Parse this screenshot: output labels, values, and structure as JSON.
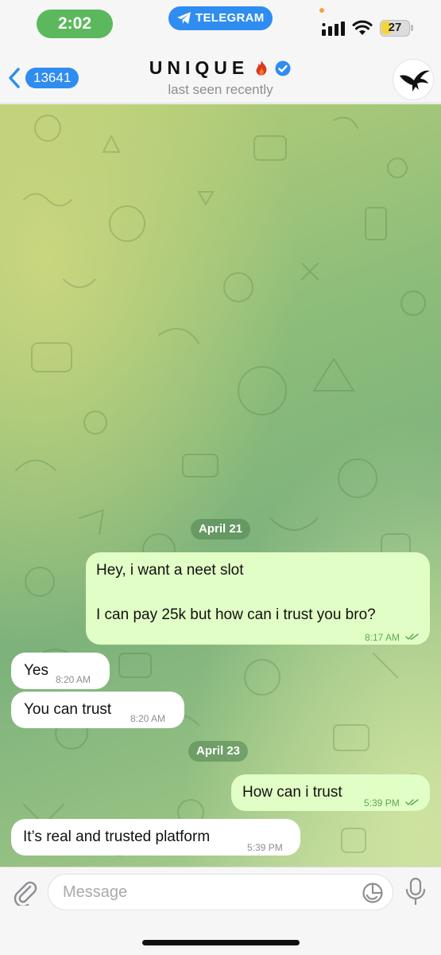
{
  "status_bar": {
    "time": "2:02",
    "app_pill": "TELEGRAM",
    "battery": "27"
  },
  "header": {
    "back_count": "13641",
    "title": "UNIQUE",
    "subtitle": "last seen recently"
  },
  "messages": [
    {
      "type": "date",
      "text": "April 21"
    },
    {
      "type": "out",
      "lines": [
        "Hey, i want a neet slot",
        "I can pay 25k but how can i trust you bro?"
      ],
      "time": "8:17 AM",
      "status": "read"
    },
    {
      "type": "in",
      "text": "Yes",
      "time": "8:20 AM"
    },
    {
      "type": "in",
      "text": "You can trust",
      "time": "8:20 AM"
    },
    {
      "type": "date",
      "text": "April 23"
    },
    {
      "type": "out",
      "text": "How can i trust",
      "time": "5:39 PM",
      "status": "read"
    },
    {
      "type": "in",
      "text": "It’s real and trusted platform",
      "time": "5:39 PM"
    }
  ],
  "input": {
    "placeholder": "Message"
  },
  "colors": {
    "accent": "#2f8cf0",
    "outgoing_bubble": "#e1fec6",
    "incoming_bubble": "#ffffff",
    "time_pill": "#5cb85c",
    "read_ticks": "#5daa55"
  },
  "icons": [
    "telegram-plane-icon",
    "signal-icon",
    "wifi-icon",
    "battery-icon",
    "chevron-left-icon",
    "fire-emoji-icon",
    "verified-badge-icon",
    "eagle-avatar-icon",
    "paperclip-icon",
    "sticker-icon",
    "microphone-icon"
  ]
}
